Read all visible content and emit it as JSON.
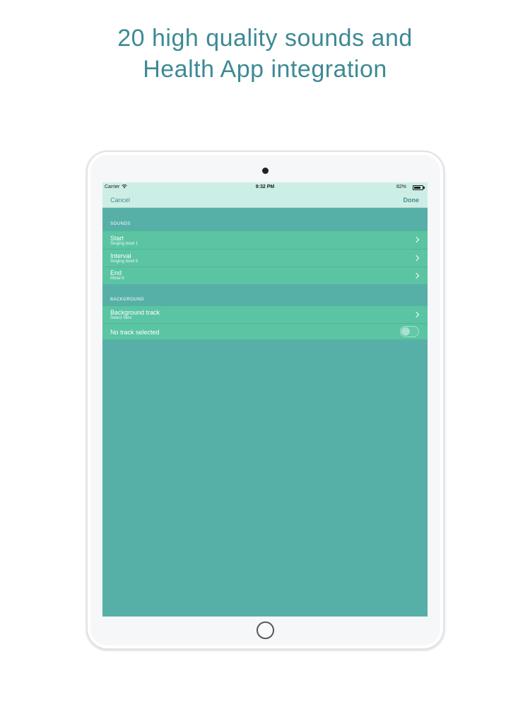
{
  "headline": {
    "line1": "20 high quality sounds and",
    "line2": "Health App integration"
  },
  "status_bar": {
    "carrier": "Carrier",
    "time": "9:32 PM",
    "battery": "82%",
    "battery_level": 0.82
  },
  "nav": {
    "cancel": "Cancel",
    "done": "Done"
  },
  "sections": [
    {
      "header": "SOUNDS",
      "rows": [
        {
          "title": "Start",
          "subtitle": "Singing bowl 1"
        },
        {
          "title": "Interval",
          "subtitle": "Singing bowl 6"
        },
        {
          "title": "End",
          "subtitle": "Metal 6"
        }
      ]
    },
    {
      "header": "BACKGROUND",
      "rows": [
        {
          "title": "Background track",
          "subtitle": "Select here"
        },
        {
          "title": "No track selected",
          "toggle_on": false
        }
      ]
    }
  ],
  "colors": {
    "headline": "#3d8a94",
    "screen_background": "#57b0a7",
    "row_background": "#5ac4a3",
    "bar_background": "#cdeee6"
  },
  "icons": [
    "wifi-icon",
    "battery-icon",
    "chevron-right-icon",
    "toggle-switch"
  ]
}
